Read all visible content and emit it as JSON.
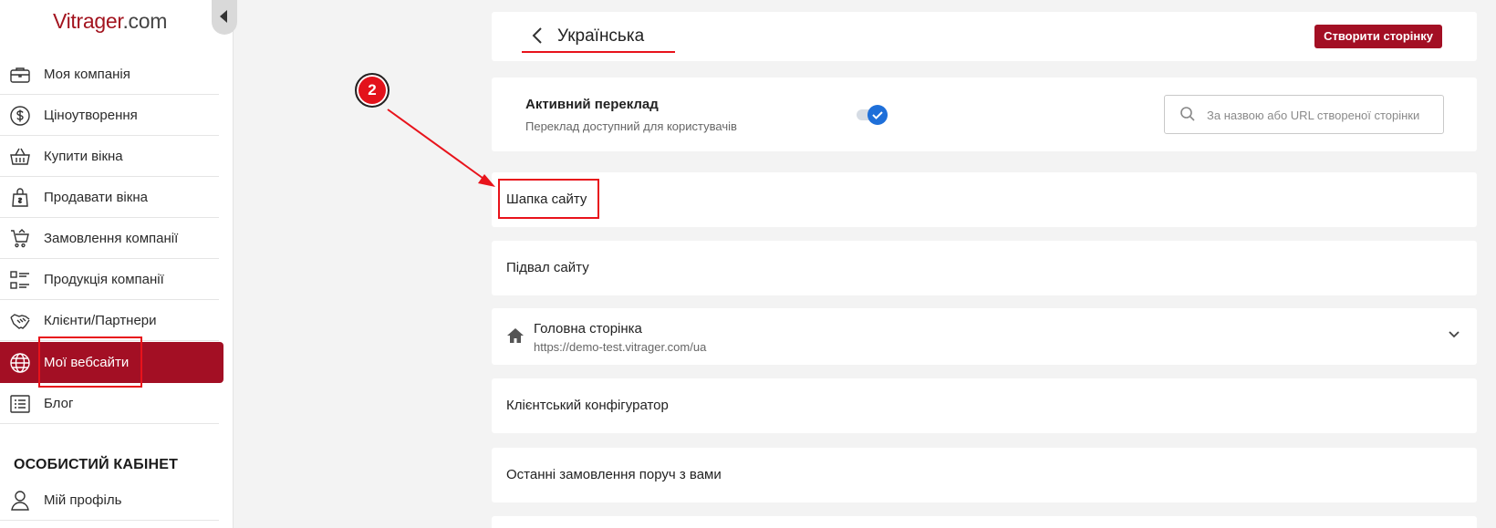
{
  "sidebar": {
    "logo_brand": "Vitrager",
    "logo_domain": ".com",
    "items": [
      {
        "label": "Моя компанія",
        "icon": "briefcase-icon"
      },
      {
        "label": "Ціноутворення",
        "icon": "dollar-circle-icon"
      },
      {
        "label": "Купити вікна",
        "icon": "basket-icon"
      },
      {
        "label": "Продавати вікна",
        "icon": "shopping-bag-icon"
      },
      {
        "label": "Замовлення компанії",
        "icon": "cart-icon"
      },
      {
        "label": "Продукція компанії",
        "icon": "list-grid-icon"
      },
      {
        "label": "Клієнти/Партнери",
        "icon": "handshake-icon"
      },
      {
        "label": "Мої вебсайти",
        "icon": "globe-icon"
      },
      {
        "label": "Блог",
        "icon": "blog-list-icon"
      }
    ],
    "section_title": "ОСОБИСТИЙ КАБІНЕТ",
    "profile_label": "Мій профіль"
  },
  "header": {
    "title": "Українська",
    "create_button": "Створити сторінку"
  },
  "settings": {
    "active_title": "Активний переклад",
    "active_subtitle": "Переклад доступний для користувачів",
    "toggle_on": true,
    "search_placeholder": "За назвою або URL створеної сторінки"
  },
  "rows": {
    "header_row": "Шапка сайту",
    "footer_row": "Підвал сайту",
    "home_title": "Головна сторінка",
    "home_url": "https://demo-test.vitrager.com/ua",
    "configurator_row": "Клієнтський конфігуратор",
    "recent_orders_row": "Останні замовлення поруч з вами"
  },
  "annotation": {
    "badge": "2"
  },
  "colors": {
    "accent": "#a30f24",
    "annotation": "#e8131b",
    "toggle": "#1e6fd9"
  }
}
